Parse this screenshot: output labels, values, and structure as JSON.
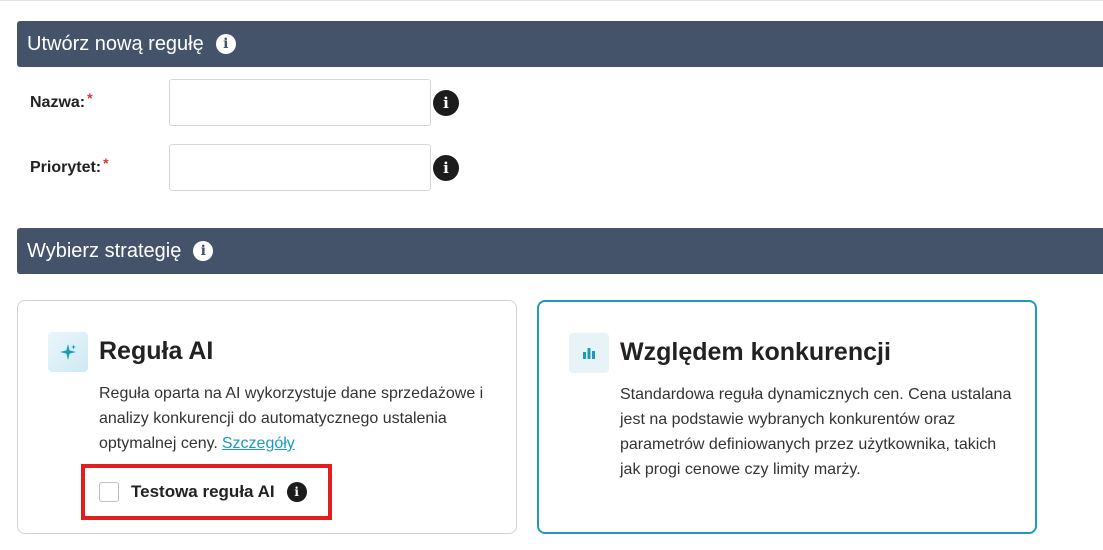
{
  "sections": {
    "create_rule": {
      "title": "Utwórz nową regułę",
      "icon": "info-icon"
    },
    "choose_strategy": {
      "title": "Wybierz strategię",
      "icon": "info-icon"
    }
  },
  "form": {
    "name": {
      "label": "Nazwa:",
      "required_mark": "*",
      "value": "",
      "icon": "info-icon"
    },
    "priority": {
      "label": "Priorytet:",
      "required_mark": "*",
      "value": "",
      "icon": "info-icon"
    }
  },
  "strategies": {
    "ai": {
      "icon": "sparkle-icon",
      "title": "Reguła AI",
      "description": "Reguła oparta na AI wykorzystuje dane sprzedażowe i analizy konkurencji do automatycznego ustalenia optymalnej ceny.",
      "details_link": "Szczegóły",
      "test_checkbox_label": "Testowa reguła AI",
      "test_checkbox_checked": false
    },
    "competition": {
      "icon": "bar-chart-icon",
      "title": "Względem konkurencji",
      "description": "Standardowa reguła dynamicznych cen. Cena ustalana jest na podstawie wybranych konkurentów oraz parametrów definiowanych przez użytkownika, takich jak progi cenowe czy limity marży.",
      "selected": true
    }
  },
  "colors": {
    "header_bg": "#45536a",
    "accent": "#1e9bbb",
    "highlight": "#e21d1d",
    "required": "#d9342b"
  }
}
